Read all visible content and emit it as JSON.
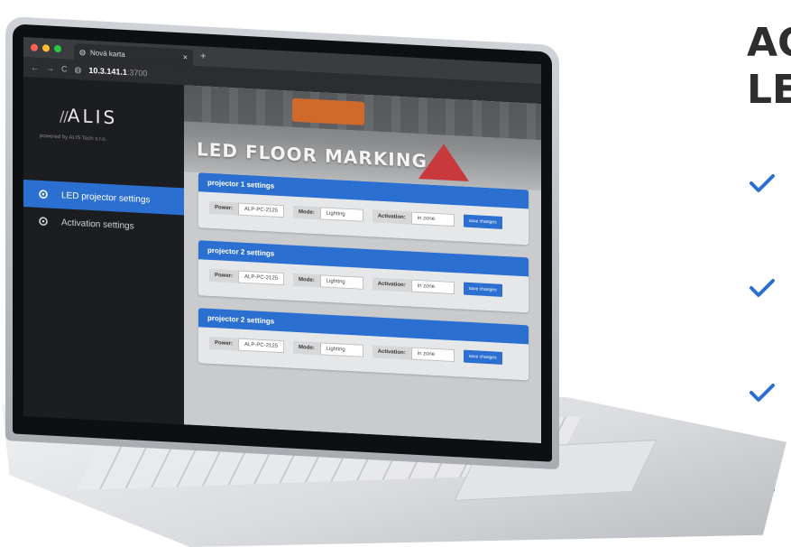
{
  "heading_lines": [
    "AC",
    "LE"
  ],
  "browser": {
    "tab_title": "Nová karta",
    "url_host": "10.3.141.1",
    "url_port": ":3700",
    "close_glyph": "×",
    "new_tab_glyph": "+"
  },
  "sidebar": {
    "logo_slashes": "//",
    "logo_text": "ALIS",
    "powered_by": "powered by ALIS Tech s.r.o.",
    "items": [
      {
        "label": "LED projector settings",
        "active": true
      },
      {
        "label": "Activation settings",
        "active": false
      }
    ]
  },
  "hero": {
    "title": "LED FLOOR MARKING"
  },
  "projectors": [
    {
      "title": "projector 1 settings",
      "power_label": "Power:",
      "power_value": "ALP-PC-2125",
      "mode_label": "Mode:",
      "mode_value": "Lighting",
      "activation_label": "Activation:",
      "activation_value": "in zone",
      "save_label": "save changes"
    },
    {
      "title": "projector 2 settings",
      "power_label": "Power:",
      "power_value": "ALP-PC-2125",
      "mode_label": "Mode:",
      "mode_value": "Lighting",
      "activation_label": "Activation:",
      "activation_value": "in zone",
      "save_label": "save changes"
    },
    {
      "title": "projector 2 settings",
      "power_label": "Power:",
      "power_value": "ALP-PC-2125",
      "mode_label": "Mode:",
      "mode_value": "Lighting",
      "activation_label": "Activation:",
      "activation_value": "in zone",
      "save_label": "save changes"
    }
  ],
  "colors": {
    "accent": "#2b6fd1",
    "check": "#2b6fd1",
    "heading": "#2e2e2e"
  },
  "icons": {
    "check": "check-icon",
    "settings": "gear-icon"
  }
}
